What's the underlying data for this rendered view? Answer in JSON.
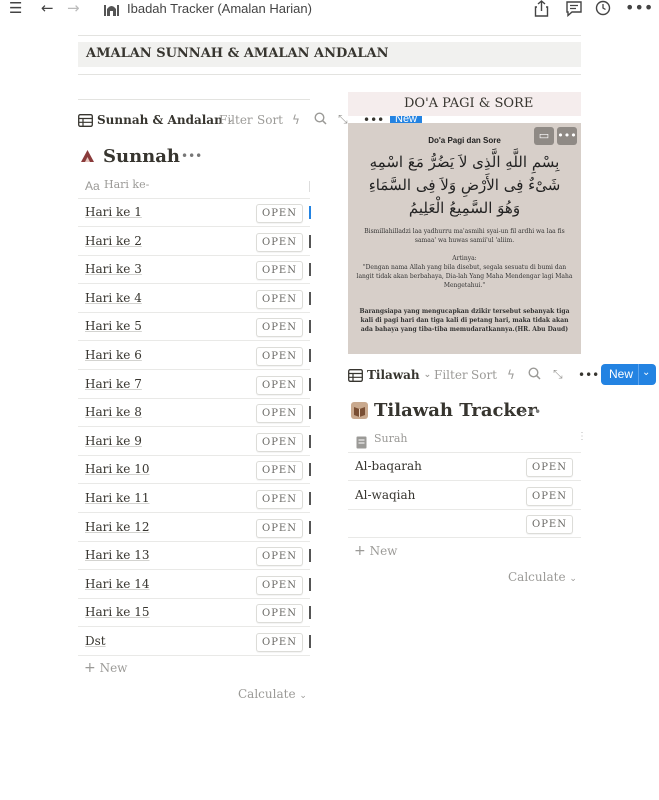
{
  "topbar": {
    "title": "Ibadah Tracker (Amalan Harian)",
    "icons": [
      "menu-icon",
      "back-arrow-icon",
      "forward-arrow-icon",
      "mosque-icon",
      "share-icon",
      "comment-icon",
      "clock-icon",
      "more-icon"
    ]
  },
  "header": {
    "title": "AMALAN SUNNAH & AMALAN ANDALAN"
  },
  "left_db": {
    "tab_label": "Sunnah & Andalan",
    "filter": "Filter",
    "sort": "Sort",
    "new_label": "New",
    "db_title": "Sunnah",
    "column_header": "Hari ke-",
    "column_prefix": "Aa",
    "open_label": "OPEN",
    "rows": [
      "Hari ke 1",
      "Hari ke 2",
      "Hari ke 3",
      "Hari ke 4",
      "Hari ke 5",
      "Hari ke 6",
      "Hari ke 7",
      "Hari ke 8",
      "Hari ke 9",
      "Hari ke 10",
      "Hari ke 11",
      "Hari ke 12",
      "Hari ke 13",
      "Hari ke 14",
      "Hari ke 15",
      "Dst"
    ],
    "add_new": "New",
    "calculate": "Calculate"
  },
  "doa": {
    "banner": "DO'A PAGI & SORE",
    "card_title": "Do'a Pagi dan Sore",
    "arabic": "بِسْمِ اللَّهِ الَّذِى لاَ يَضُرُّ مَعَ اسْمِهِ شَىْءٌ فِى الأَرْضِ وَلاَ فِى السَّمَاءِ وَهُوَ السَّمِيعُ الْعَلِيمُ",
    "latin": "Bismillahilladzi laa yadhurru ma'asmihi syai-un fil ardhi wa laa fis samaa' wa huwas samii'ul 'aliim.",
    "artinya_label": "Artinya:",
    "meaning": "\"Dengan nama Allah yang bila disebut, segala sesuatu di bumi dan langit tidak akan berbahaya, Dia-lah Yang Maha Mendengar lagi Maha Mengetahui.\"",
    "note": "Barangsiapa yang mengucapkan dzikir tersebut sebanyak tiga kali di pagi hari dan tiga kali di petang hari, maka tidak akan ada bahaya yang tiba-tiba memudaratkannya.(HR. Abu Daud)"
  },
  "right_db": {
    "tab_label": "Tilawah",
    "filter": "Filter",
    "sort": "Sort",
    "new_label": "New",
    "db_title": "Tilawah Tracker",
    "column_header": "Surah",
    "open_label": "OPEN",
    "rows": [
      "Al-baqarah",
      "Al-waqiah",
      ""
    ],
    "add_new": "New",
    "calculate": "Calculate"
  },
  "colors": {
    "accent": "#2383e2",
    "card_bg": "#d7cfc9",
    "banner_bg": "#f5eded",
    "header_bg": "#f1f1ef"
  }
}
